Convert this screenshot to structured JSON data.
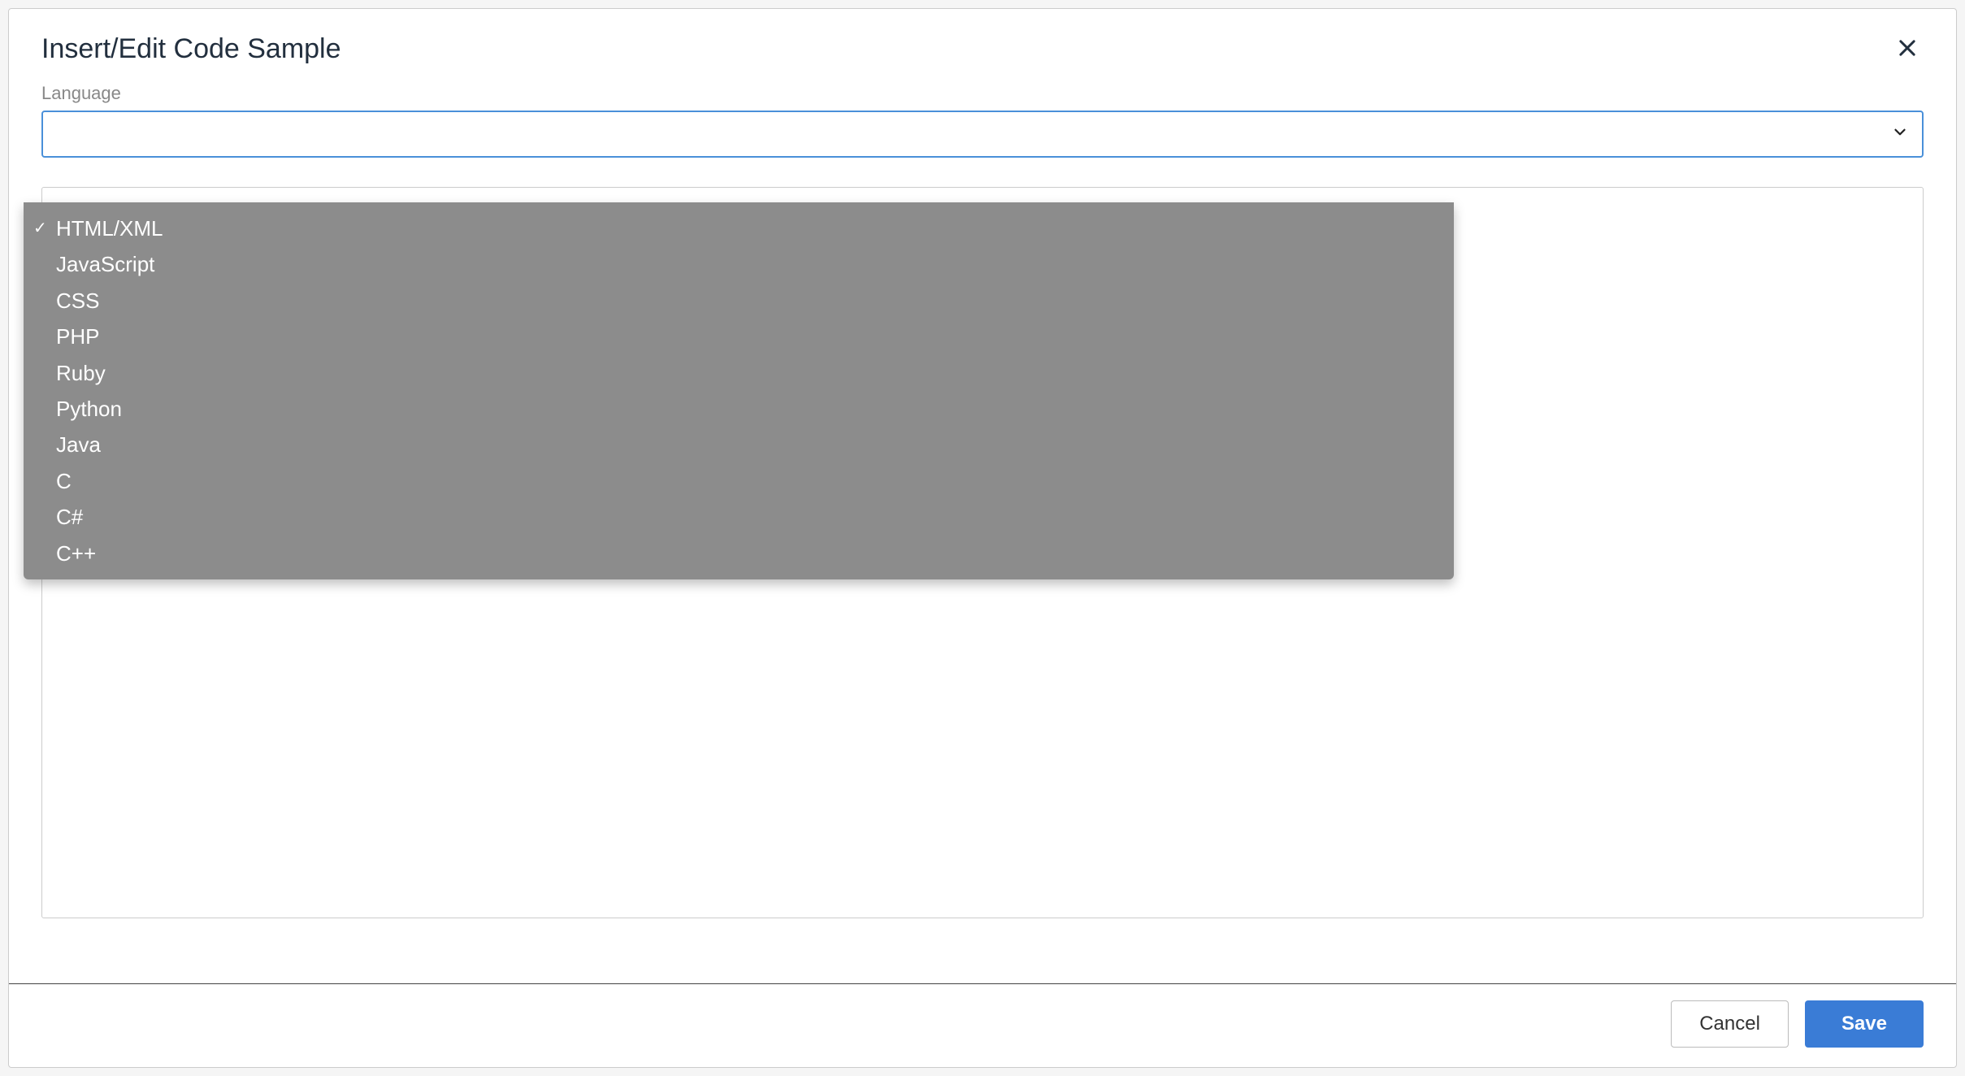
{
  "dialog": {
    "title": "Insert/Edit Code Sample",
    "close_icon": "close-icon"
  },
  "language": {
    "label": "Language",
    "selected": "HTML/XML",
    "options": [
      {
        "label": "HTML/XML",
        "selected": true
      },
      {
        "label": "JavaScript",
        "selected": false
      },
      {
        "label": "CSS",
        "selected": false
      },
      {
        "label": "PHP",
        "selected": false
      },
      {
        "label": "Ruby",
        "selected": false
      },
      {
        "label": "Python",
        "selected": false
      },
      {
        "label": "Java",
        "selected": false
      },
      {
        "label": "C",
        "selected": false
      },
      {
        "label": "C#",
        "selected": false
      },
      {
        "label": "C++",
        "selected": false
      }
    ]
  },
  "code": {
    "value": ""
  },
  "footer": {
    "cancel_label": "Cancel",
    "save_label": "Save"
  }
}
